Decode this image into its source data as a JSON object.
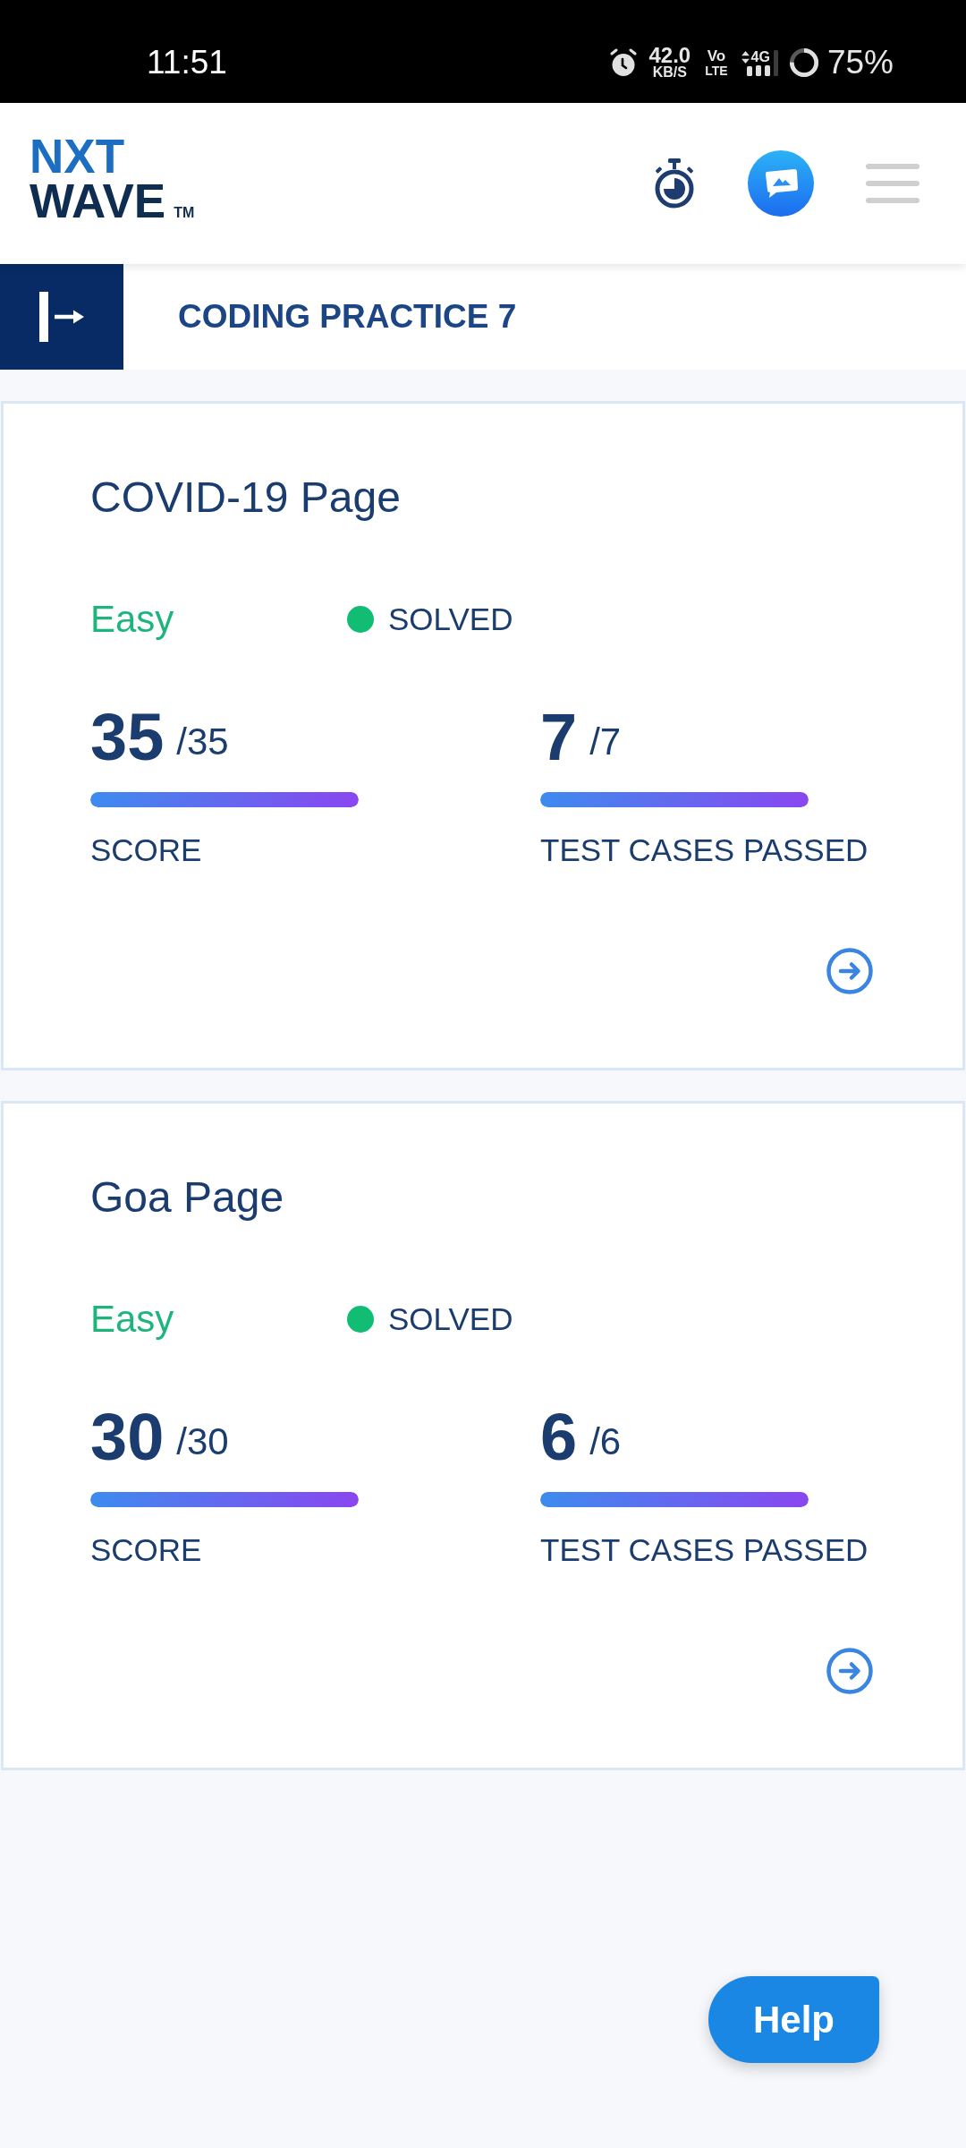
{
  "status_bar": {
    "time": "11:51",
    "net_speed": "42.0",
    "net_speed_unit": "KB/S",
    "volte_top": "Vo",
    "volte_bottom": "LTE",
    "network": "4G",
    "battery": "75%"
  },
  "header": {
    "logo": {
      "line_1": "NXT",
      "line_2": "WAVE",
      "trademark": "TM"
    }
  },
  "title_bar": {
    "title": "CODING PRACTICE 7"
  },
  "problems": [
    {
      "title": "COVID-19 Page",
      "difficulty": "Easy",
      "status": "SOLVED",
      "stats": [
        {
          "value": "35",
          "total": "/35",
          "level": 1,
          "label": "SCORE"
        },
        {
          "value": "7",
          "total": "/7",
          "level": 1,
          "label": "TEST CASES PASSED"
        }
      ]
    },
    {
      "title": "Goa Page",
      "difficulty": "Easy",
      "status": "SOLVED",
      "stats": [
        {
          "value": "30",
          "total": "/30",
          "level": 1,
          "label": "SCORE"
        },
        {
          "value": "6",
          "total": "/6",
          "level": 1,
          "label": "TEST CASES PASSED"
        }
      ]
    }
  ],
  "help_button": {
    "label": "Help"
  }
}
